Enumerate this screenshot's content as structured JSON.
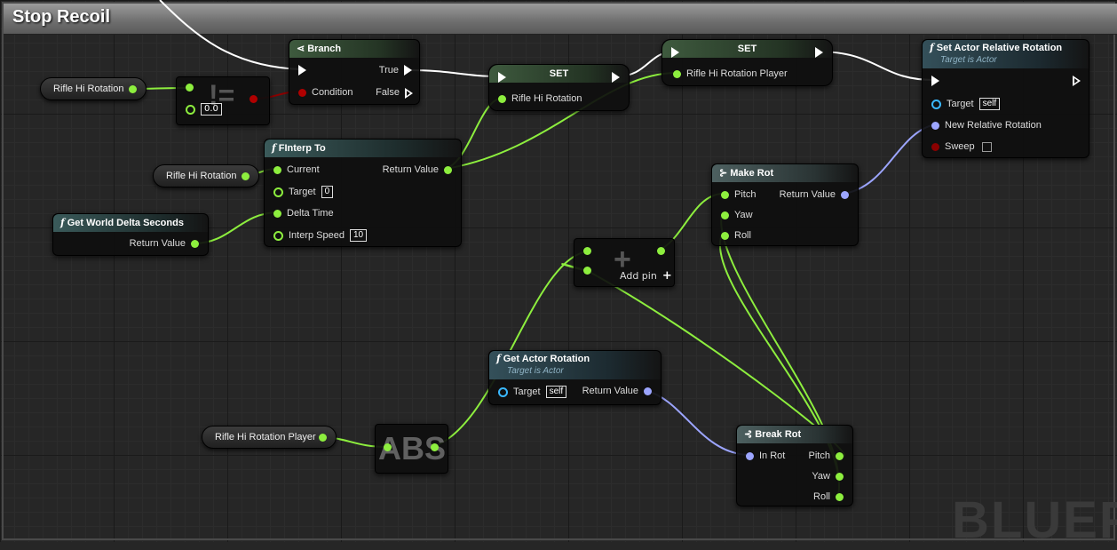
{
  "graph": {
    "title": "Stop Recoil",
    "watermark": "BLUEPRINT"
  },
  "vars": {
    "rifle_hi_rotation_1": "Rifle Hi Rotation",
    "rifle_hi_rotation_2": "Rifle Hi Rotation",
    "rifle_hi_rotation_player": "Rifle Hi Rotation Player"
  },
  "compare": {
    "symbol": "!=",
    "b_value": "0.0"
  },
  "branch": {
    "title": "Branch",
    "true": "True",
    "condition": "Condition",
    "false": "False"
  },
  "set1": {
    "title": "SET",
    "pin": "Rifle Hi Rotation"
  },
  "set2": {
    "title": "SET",
    "pin": "Rifle Hi Rotation Player"
  },
  "set_actor_rel_rot": {
    "title": "Set Actor Relative Rotation",
    "subtitle": "Target is Actor",
    "target": "Target",
    "target_value": "self",
    "new_rot": "New Relative Rotation",
    "sweep": "Sweep"
  },
  "finterp": {
    "title": "FInterp To",
    "current": "Current",
    "return": "Return Value",
    "target": "Target",
    "target_value": "0",
    "delta": "Delta Time",
    "speed": "Interp Speed",
    "speed_value": "10"
  },
  "world_delta": {
    "title": "Get World Delta Seconds",
    "return": "Return Value"
  },
  "make_rot": {
    "title": "Make Rot",
    "pitch": "Pitch",
    "return": "Return Value",
    "yaw": "Yaw",
    "roll": "Roll"
  },
  "add": {
    "symbol": "+",
    "add_pin": "Add pin",
    "add_pin_symbol": "+"
  },
  "get_actor_rot": {
    "title": "Get Actor Rotation",
    "subtitle": "Target is Actor",
    "target": "Target",
    "target_value": "self",
    "return": "Return Value"
  },
  "abs": {
    "label": "ABS"
  },
  "break_rot": {
    "title": "Break Rot",
    "in_rot": "In Rot",
    "pitch": "Pitch",
    "yaw": "Yaw",
    "roll": "Roll"
  },
  "colors": {
    "float_pin": "#8dee3e",
    "rotator_pin": "#9ca5ff",
    "bool_pin": "#8a0000",
    "object_pin": "#3ab8ff",
    "exec_wire": "#ffffff"
  }
}
